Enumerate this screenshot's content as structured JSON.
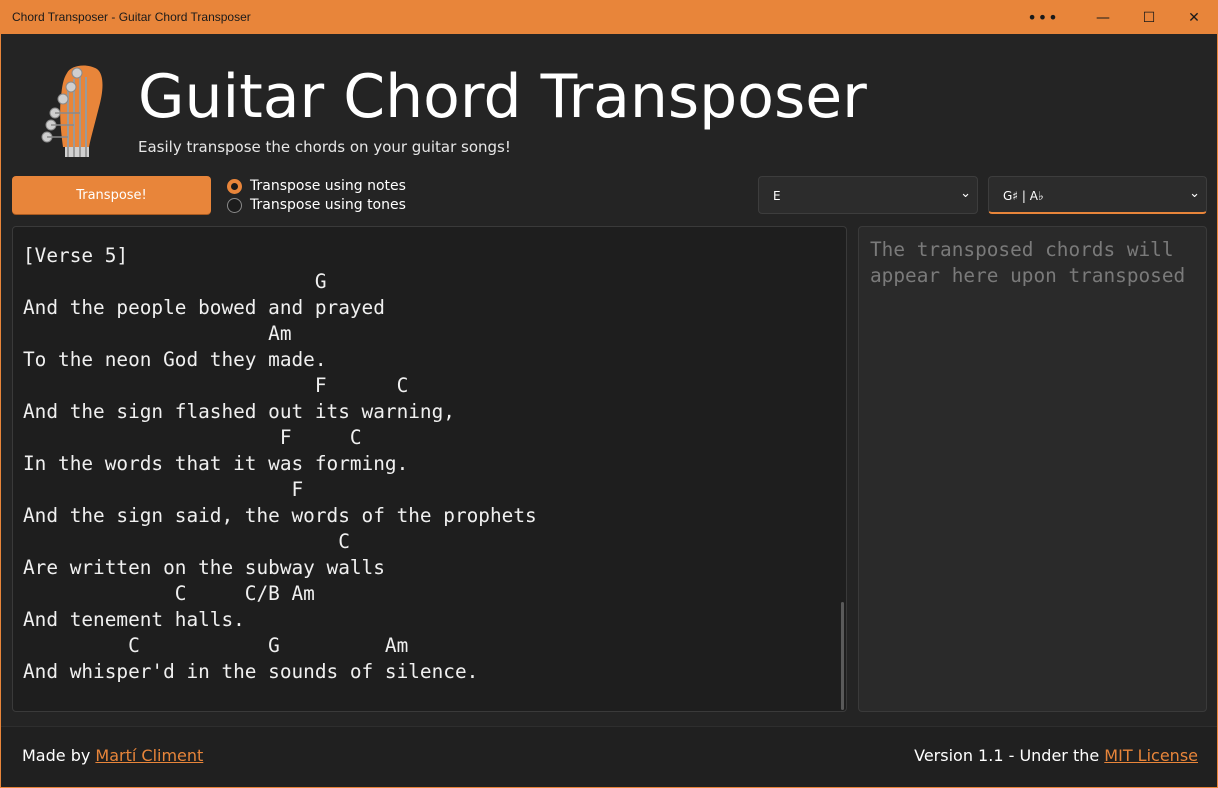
{
  "window": {
    "title": "Chord Transposer - Guitar Chord Transposer",
    "more_glyph": "•••",
    "minimize_glyph": "—",
    "maximize_glyph": "☐",
    "close_glyph": "✕"
  },
  "header": {
    "logo_icon": "guitar-headstock-icon",
    "title": "Guitar Chord Transposer",
    "subtitle": "Easily transpose the chords on your guitar songs!"
  },
  "controls": {
    "transpose_label": "Transpose!",
    "radio_notes_label": "Transpose using notes",
    "radio_tones_label": "Transpose using tones",
    "selected_mode": "notes",
    "from_key": "E",
    "to_key": "G♯ | A♭",
    "chevron_glyph": "⌄"
  },
  "input": {
    "text": "[Verse 5]\n                         G\nAnd the people bowed and prayed\n                     Am\nTo the neon God they made.\n                         F      C\nAnd the sign flashed out its warning,\n                      F     C\nIn the words that it was forming.\n                       F\nAnd the sign said, the words of the prophets\n                           C\nAre written on the subway walls\n             C     C/B Am\nAnd tenement halls.\n         C           G         Am\nAnd whisper'd in the sounds of silence."
  },
  "output": {
    "placeholder": "The transposed chords will appear here upon transposed"
  },
  "footer": {
    "made_by_prefix": "Made by ",
    "author": "Martí Climent",
    "version_prefix": "Version 1.1 - Under the ",
    "license": "MIT License"
  },
  "colors": {
    "accent": "#e8853a",
    "background": "#242424",
    "panel": "#1e1e1e"
  }
}
